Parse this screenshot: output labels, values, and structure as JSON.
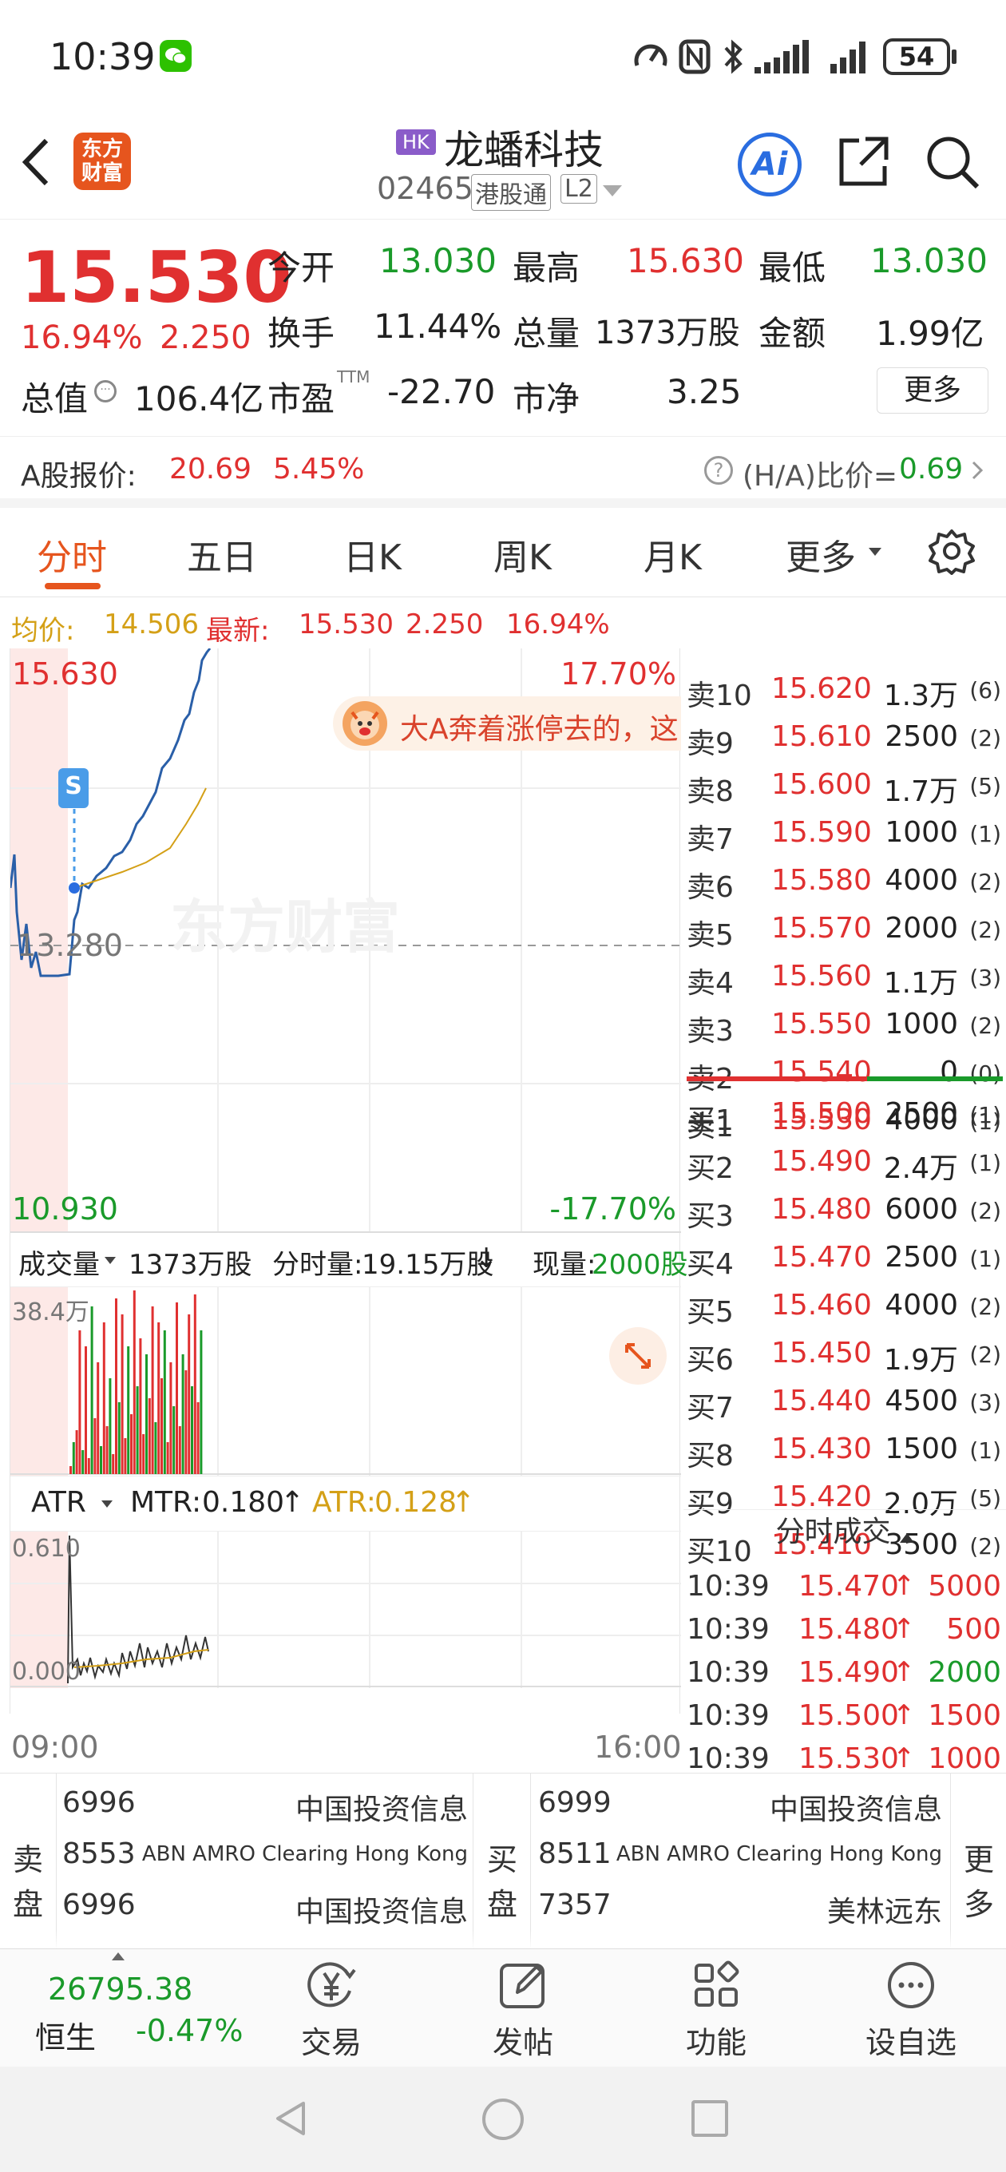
{
  "status_bar": {
    "time": "10:39",
    "battery": "54"
  },
  "header": {
    "market_tag": "HK",
    "stock_name": "龙蟠科技",
    "stock_code": "02465",
    "connect_tag": "港股通",
    "level_tag": "L2",
    "logo_text": "东方财富",
    "ai_label": "Ai"
  },
  "quote": {
    "price": "15.530",
    "change_pct": "16.94%",
    "change": "2.250",
    "fields": [
      {
        "label": "今开",
        "value": "13.030"
      },
      {
        "label": "最高",
        "value": "15.630"
      },
      {
        "label": "最低",
        "value": "13.030"
      },
      {
        "label": "换手",
        "value": "11.44%"
      },
      {
        "label": "总量",
        "value": "1373万股"
      },
      {
        "label": "金额",
        "value": "1.99亿"
      },
      {
        "label": "总值",
        "value": "106.4亿"
      },
      {
        "label": "市盈",
        "sup": "TTM",
        "value": "-22.70"
      },
      {
        "label": "市净",
        "value": "3.25"
      }
    ],
    "more_btn": "更多"
  },
  "a_share": {
    "label": "A股报价:",
    "price": "20.69",
    "pct": "5.45%",
    "ratio_label": "(H/A)比价=",
    "ratio_value": "0.69"
  },
  "tabs": [
    "分时",
    "五日",
    "日K",
    "周K",
    "月K",
    "更多"
  ],
  "avg_line": {
    "avg_label": "均价:",
    "avg_value": "14.506",
    "latest_label": "最新:",
    "latest_value": "15.530",
    "change": "2.250",
    "pct": "16.94%"
  },
  "chart": {
    "top_price": "15.630",
    "top_pct": "17.70%",
    "mid_price": "13.280",
    "bottom_price": "10.930",
    "bottom_pct": "-17.70%",
    "banner": "大A奔着涨停去的，这",
    "watermark": "东方财富",
    "s_marker": "S"
  },
  "volume_bar": {
    "selector": "成交量",
    "total": "1373万股",
    "minute_label": "分时量:",
    "minute_value": "19.15万股",
    "now_label": "现量:",
    "now_value": "2000股",
    "max_label": "38.4万"
  },
  "atr_bar": {
    "selector": "ATR",
    "mtr_label": "MTR:",
    "mtr_value": "0.180",
    "atr_label": "ATR:",
    "atr_value": "0.128",
    "y_top": "0.610",
    "y_bottom": "0.000"
  },
  "time_axis": {
    "start": "09:00",
    "end": "16:00"
  },
  "order_book": {
    "asks": [
      {
        "label": "卖10",
        "price": "15.620",
        "vol": "1.3万",
        "cnt": "(6)"
      },
      {
        "label": "卖9",
        "price": "15.610",
        "vol": "2500",
        "cnt": "(2)"
      },
      {
        "label": "卖8",
        "price": "15.600",
        "vol": "1.7万",
        "cnt": "(5)"
      },
      {
        "label": "卖7",
        "price": "15.590",
        "vol": "1000",
        "cnt": "(1)"
      },
      {
        "label": "卖6",
        "price": "15.580",
        "vol": "4000",
        "cnt": "(2)"
      },
      {
        "label": "卖5",
        "price": "15.570",
        "vol": "2000",
        "cnt": "(2)"
      },
      {
        "label": "卖4",
        "price": "15.560",
        "vol": "1.1万",
        "cnt": "(3)"
      },
      {
        "label": "卖3",
        "price": "15.550",
        "vol": "1000",
        "cnt": "(2)"
      },
      {
        "label": "卖2",
        "price": "15.540",
        "vol": "0",
        "cnt": "(0)"
      },
      {
        "label": "卖1",
        "price": "15.530",
        "vol": "4000",
        "cnt": "(1)"
      }
    ],
    "bids": [
      {
        "label": "买1",
        "price": "15.500",
        "vol": "2500",
        "cnt": "(1)"
      },
      {
        "label": "买2",
        "price": "15.490",
        "vol": "2.4万",
        "cnt": "(1)"
      },
      {
        "label": "买3",
        "price": "15.480",
        "vol": "6000",
        "cnt": "(2)"
      },
      {
        "label": "买4",
        "price": "15.470",
        "vol": "2500",
        "cnt": "(1)"
      },
      {
        "label": "买5",
        "price": "15.460",
        "vol": "4000",
        "cnt": "(2)"
      },
      {
        "label": "买6",
        "price": "15.450",
        "vol": "1.9万",
        "cnt": "(2)"
      },
      {
        "label": "买7",
        "price": "15.440",
        "vol": "4500",
        "cnt": "(3)"
      },
      {
        "label": "买8",
        "price": "15.430",
        "vol": "1500",
        "cnt": "(1)"
      },
      {
        "label": "买9",
        "price": "15.420",
        "vol": "2.0万",
        "cnt": "(5)"
      },
      {
        "label": "买10",
        "price": "15.410",
        "vol": "3500",
        "cnt": "(2)"
      }
    ]
  },
  "ticks": {
    "title": "分时成交",
    "rows": [
      {
        "time": "10:39",
        "price": "15.470",
        "vol": "5000",
        "dir": "up",
        "color": "red"
      },
      {
        "time": "10:39",
        "price": "15.480",
        "vol": "500",
        "dir": "up",
        "color": "red"
      },
      {
        "time": "10:39",
        "price": "15.490",
        "vol": "2000",
        "dir": "up",
        "color": "green"
      },
      {
        "time": "10:39",
        "price": "15.500",
        "vol": "1500",
        "dir": "up",
        "color": "red"
      },
      {
        "time": "10:39",
        "price": "15.530",
        "vol": "1000",
        "dir": "up",
        "color": "red"
      }
    ]
  },
  "brokers": {
    "sell_label": [
      "卖",
      "盘"
    ],
    "buy_label": [
      "买",
      "盘"
    ],
    "more_label": [
      "更",
      "多"
    ],
    "sell": [
      {
        "id": "6996",
        "name": "中国投资信息"
      },
      {
        "id": "8553",
        "name": "ABN AMRO Clearing Hong Kong"
      },
      {
        "id": "6996",
        "name": "中国投资信息"
      }
    ],
    "buy": [
      {
        "id": "6999",
        "name": "中国投资信息"
      },
      {
        "id": "8511",
        "name": "ABN AMRO Clearing Hong Kong"
      },
      {
        "id": "7357",
        "name": "美林远东"
      }
    ]
  },
  "bottom_nav": {
    "index_value": "26795.38",
    "index_name": "恒生",
    "index_pct": "-0.47%",
    "items": [
      {
        "label": "交易",
        "icon": "yen-icon"
      },
      {
        "label": "发帖",
        "icon": "edit-icon"
      },
      {
        "label": "功能",
        "icon": "grid-icon"
      },
      {
        "label": "设自选",
        "icon": "more-dots-icon"
      }
    ]
  },
  "colors": {
    "up": "#e03030",
    "down": "#1a9a2a",
    "avg": "#d4a017",
    "accent": "#e6551e",
    "line": "#2a5fa8"
  }
}
